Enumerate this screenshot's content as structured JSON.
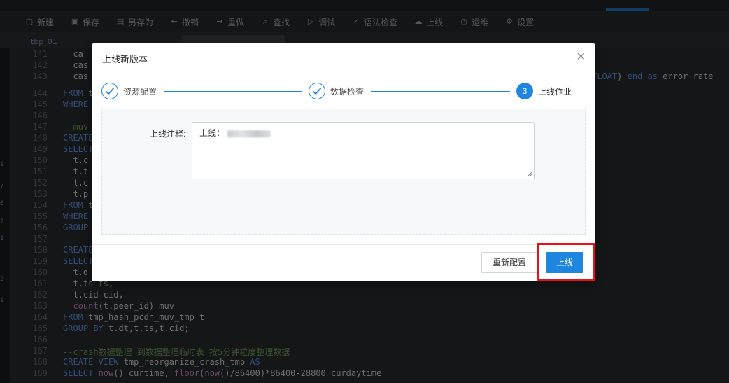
{
  "toolbar": {
    "items": [
      {
        "label": "新建",
        "icon": "file-plus-icon",
        "glyph": "▢"
      },
      {
        "label": "保存",
        "icon": "save-icon",
        "glyph": "▣"
      },
      {
        "label": "另存为",
        "icon": "save-as-icon",
        "glyph": "▤"
      },
      {
        "label": "撤销",
        "icon": "undo-icon",
        "glyph": "←"
      },
      {
        "label": "重做",
        "icon": "redo-icon",
        "glyph": "→"
      },
      {
        "label": "查找",
        "icon": "search-icon",
        "glyph": "⌕"
      },
      {
        "label": "调试",
        "icon": "debug-icon",
        "glyph": "▷"
      },
      {
        "label": "语法检查",
        "icon": "syntax-check-icon",
        "glyph": "✓"
      },
      {
        "label": "上线",
        "icon": "cloud-icon",
        "glyph": "☁"
      },
      {
        "label": "运维",
        "icon": "clock-icon",
        "glyph": "◷"
      },
      {
        "label": "设置",
        "icon": "gear-icon",
        "glyph": "⚙"
      }
    ]
  },
  "tabs": [
    "tbp_01",
    "",
    ""
  ],
  "left_gutter": [
    "1",
    "/",
    "0",
    "2",
    "1",
    "2",
    "1"
  ],
  "editor_lines": [
    {
      "n": "141",
      "code": "  ca"
    },
    {
      "n": "142",
      "code": "  cas"
    },
    {
      "n": "143",
      "code": "  cas",
      "tail": "FLOAT) end as error_rate"
    },
    {
      "n": "",
      "code": ""
    },
    {
      "n": "144",
      "code": "FROM t"
    },
    {
      "n": "145",
      "code": "WHERE"
    },
    {
      "n": "146",
      "code": ""
    },
    {
      "n": "147",
      "code": "--muv"
    },
    {
      "n": "148",
      "code": "CREATE"
    },
    {
      "n": "149",
      "code": "SELECT"
    },
    {
      "n": "150",
      "code": "  t.c"
    },
    {
      "n": "151",
      "code": "  t.t"
    },
    {
      "n": "152",
      "code": "  t.c"
    },
    {
      "n": "153",
      "code": "  t.p"
    },
    {
      "n": "154",
      "code": "FROM t"
    },
    {
      "n": "155",
      "code": "WHERE"
    },
    {
      "n": "156",
      "code": "GROUP"
    },
    {
      "n": "157",
      "code": ""
    },
    {
      "n": "158",
      "code": "CREATE"
    },
    {
      "n": "159",
      "code": "SELECT"
    },
    {
      "n": "160",
      "code": "  t.d"
    },
    {
      "n": "161",
      "code": "  t.ts ts,"
    },
    {
      "n": "162",
      "code": "  t.cid cid,"
    },
    {
      "n": "163",
      "code": "  count(t.peer_id) muv"
    },
    {
      "n": "164",
      "code": "FROM tmp_hash_pcdn_muv_tmp t"
    },
    {
      "n": "165",
      "code": "GROUP BY t.dt,t.ts,t.cid;"
    },
    {
      "n": "166",
      "code": ""
    },
    {
      "n": "167",
      "code": "--crash数据整理 到数据整理临时表 按5分钟粒度整理数据"
    },
    {
      "n": "168",
      "code": "CREATE VIEW tmp_reorganize_crash_tmp AS"
    },
    {
      "n": "169",
      "code": "SELECT now() curtime, floor(now()/86400)*86400-28800 curdaytime"
    }
  ],
  "modal": {
    "title": "上线新版本",
    "close_icon": "close-icon",
    "steps": [
      {
        "label": "资源配置",
        "status": "done"
      },
      {
        "label": "数据检查",
        "status": "done"
      },
      {
        "label": "上线作业",
        "status": "current",
        "number": "3"
      }
    ],
    "form": {
      "label": "上线注释:",
      "value": "上线："
    },
    "buttons": {
      "reset": "重新配置",
      "publish": "上线"
    },
    "highlight_color": "#e8111a",
    "accent_color": "#1f86e0"
  }
}
